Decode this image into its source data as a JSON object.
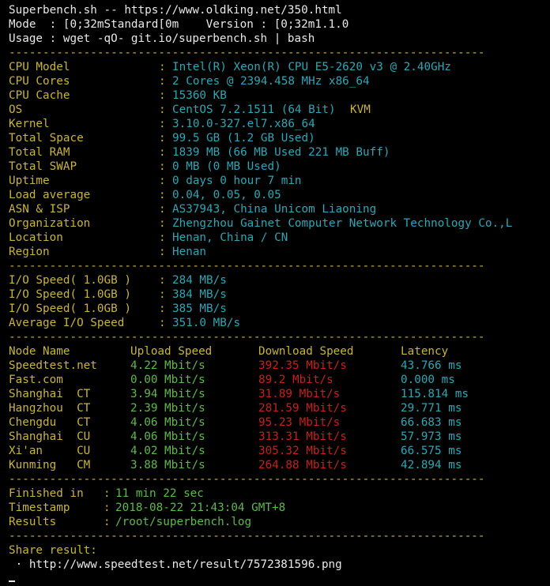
{
  "header": {
    "line1": "Superbench.sh -- https://www.oldking.net/350.html",
    "line2": "Mode  : [0;32mStandard[0m    Version : [0;32m1.1.0",
    "line3": "Usage : wget -qO- git.io/superbench.sh | bash"
  },
  "divider": "----------------------------------------------------------------------",
  "colors": {
    "background": "#000000",
    "text_white": "#e8e8e8",
    "label_yellow": "#c8b43c",
    "value_cyan": "#2fa6b4",
    "value_green": "#5fb84b",
    "value_red": "#c2231d"
  },
  "sysinfo": [
    {
      "label": "CPU Model",
      "value": "Intel(R) Xeon(R) CPU E5-2620 v3 @ 2.40GHz"
    },
    {
      "label": "CPU Cores",
      "value": "2 Cores @ 2394.458 MHz x86_64"
    },
    {
      "label": "CPU Cache",
      "value": "15360 KB"
    },
    {
      "label": "OS",
      "value": "CentOS 7.2.1511 (64 Bit)",
      "extra": "KVM"
    },
    {
      "label": "Kernel",
      "value": "3.10.0-327.el7.x86_64"
    },
    {
      "label": "Total Space",
      "value": "99.5 GB (1.2 GB Used)"
    },
    {
      "label": "Total RAM",
      "value": "1839 MB (66 MB Used 221 MB Buff)"
    },
    {
      "label": "Total SWAP",
      "value": "0 MB (0 MB Used)"
    },
    {
      "label": "Uptime",
      "value": "0 days 0 hour 7 min"
    },
    {
      "label": "Load average",
      "value": "0.04, 0.05, 0.05"
    },
    {
      "label": "ASN & ISP",
      "value": "AS37943, China Unicom Liaoning"
    },
    {
      "label": "Organization",
      "value": "Zhengzhou Gainet Computer Network Technology Co.,L"
    },
    {
      "label": "Location",
      "value": "Henan, China / CN"
    },
    {
      "label": "Region",
      "value": "Henan"
    }
  ],
  "io": [
    {
      "label": "I/O Speed( 1.0GB )",
      "value": "284 MB/s"
    },
    {
      "label": "I/O Speed( 1.0GB )",
      "value": "384 MB/s"
    },
    {
      "label": "I/O Speed( 1.0GB )",
      "value": "385 MB/s"
    },
    {
      "label": "Average I/O Speed",
      "value": "351.0 MB/s"
    }
  ],
  "speedtest": {
    "headers": [
      "Node Name",
      "Upload Speed",
      "Download Speed",
      "Latency"
    ],
    "rows": [
      {
        "node": "Speedtest.net",
        "upload": "4.22 Mbit/s",
        "download": "392.35 Mbit/s",
        "latency": "43.766 ms"
      },
      {
        "node": "Fast.com",
        "upload": "0.00 Mbit/s",
        "download": "89.2 Mbit/s",
        "latency": "0.000 ms"
      },
      {
        "node": "Shanghai  CT",
        "upload": "3.94 Mbit/s",
        "download": "31.89 Mbit/s",
        "latency": "115.814 ms"
      },
      {
        "node": "Hangzhou  CT",
        "upload": "2.39 Mbit/s",
        "download": "281.59 Mbit/s",
        "latency": "29.771 ms"
      },
      {
        "node": "Chengdu   CT",
        "upload": "4.06 Mbit/s",
        "download": "95.23 Mbit/s",
        "latency": "66.683 ms"
      },
      {
        "node": "Shanghai  CU",
        "upload": "4.06 Mbit/s",
        "download": "313.31 Mbit/s",
        "latency": "57.973 ms"
      },
      {
        "node": "Xi'an     CU",
        "upload": "4.02 Mbit/s",
        "download": "305.32 Mbit/s",
        "latency": "66.575 ms"
      },
      {
        "node": "Kunming   CM",
        "upload": "3.88 Mbit/s",
        "download": "264.88 Mbit/s",
        "latency": "42.894 ms"
      }
    ]
  },
  "footer": [
    {
      "label": "Finished in",
      "value": "11 min 22 sec"
    },
    {
      "label": "Timestamp",
      "value": "2018-08-22 21:43:04 GMT+8"
    },
    {
      "label": "Results",
      "value": "/root/superbench.log"
    }
  ],
  "share": {
    "title": "Share result:",
    "link": " · http://www.speedtest.net/result/7572381596.png"
  }
}
